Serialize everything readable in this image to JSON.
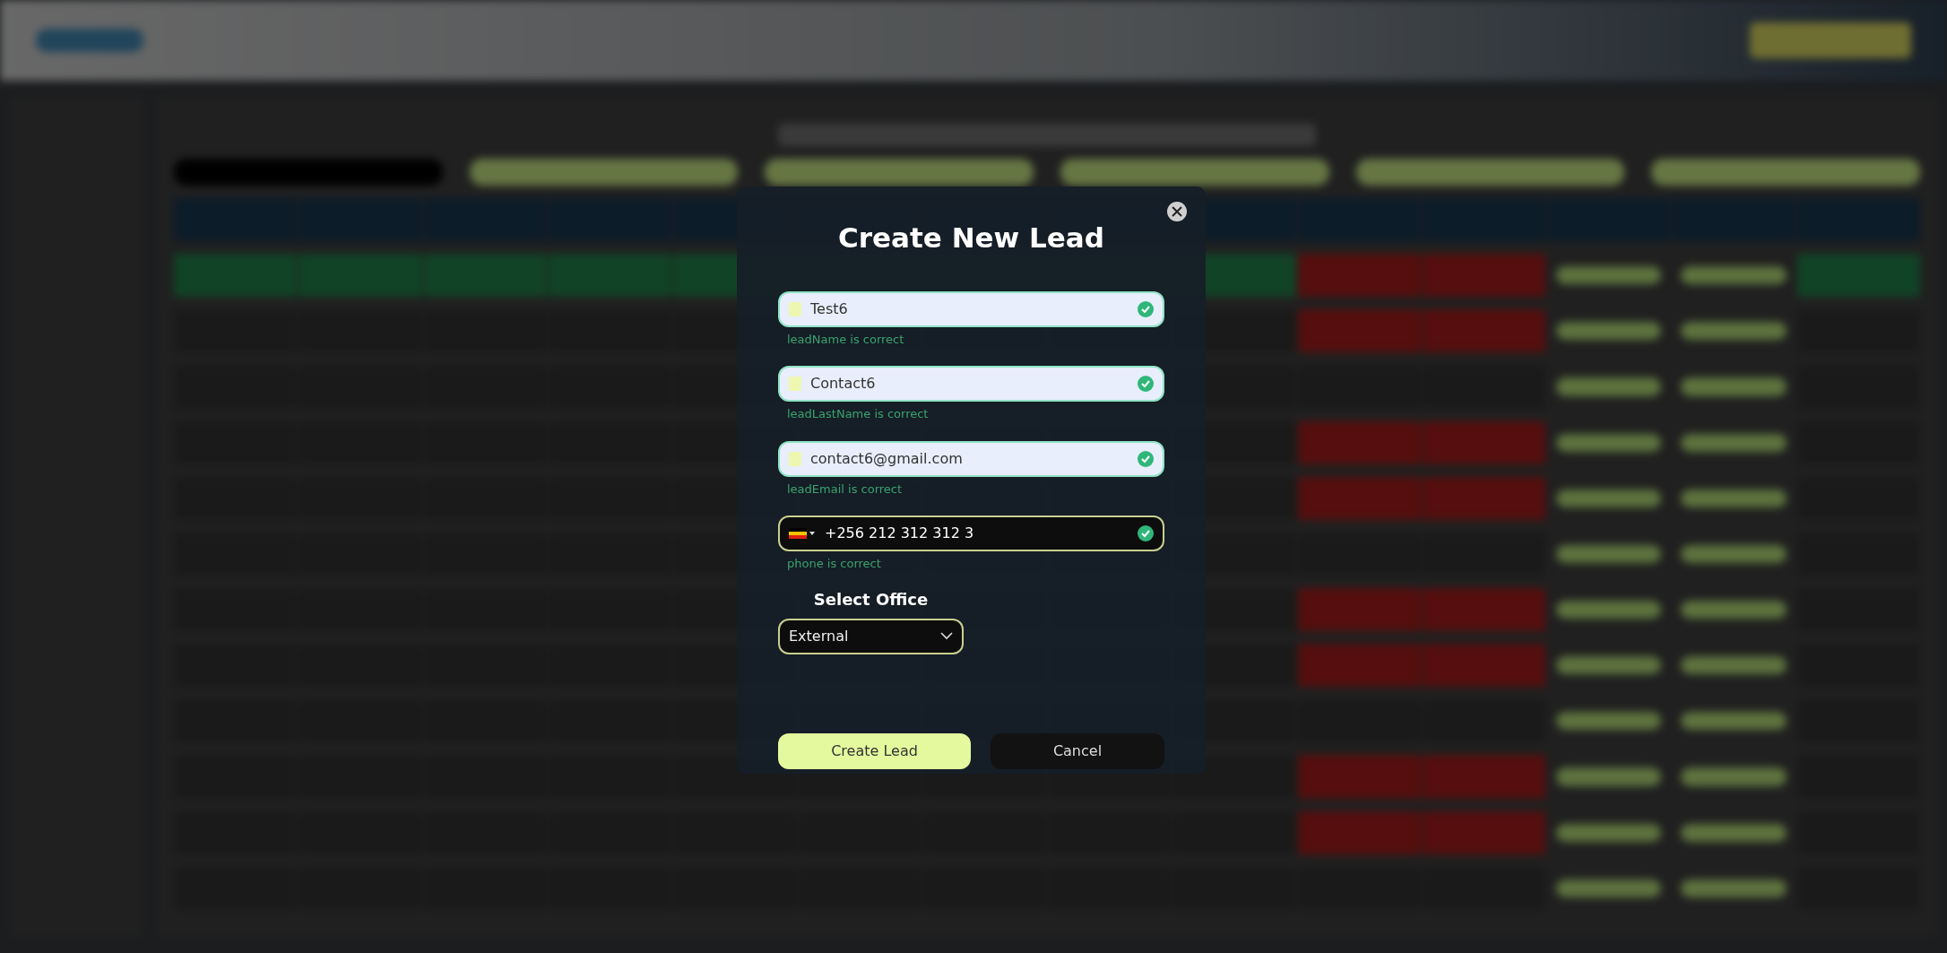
{
  "modal": {
    "title": "Create New Lead",
    "fields": [
      {
        "kind": "text",
        "value": "Test6",
        "valid": true,
        "message": "leadName is correct"
      },
      {
        "kind": "text",
        "value": "Contact6",
        "valid": true,
        "message": "leadLastName is correct"
      },
      {
        "kind": "email",
        "value": "contact6@gmail.com",
        "valid": true,
        "message": "leadEmail is correct"
      },
      {
        "kind": "phone",
        "value": "+256 212 312 312 3",
        "valid": true,
        "message": "phone is correct"
      }
    ],
    "office": {
      "label": "Select Office",
      "value": "External"
    },
    "buttons": [
      {
        "kind": "primary",
        "label": "Create Lead"
      },
      {
        "kind": "dark",
        "label": "Cancel"
      }
    ]
  }
}
